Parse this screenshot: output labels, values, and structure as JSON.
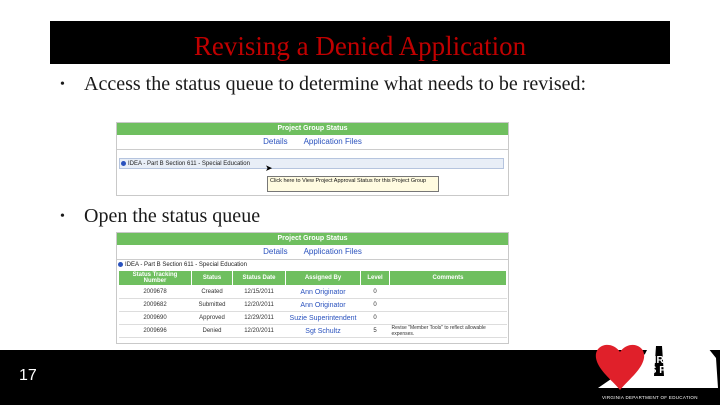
{
  "slide": {
    "title": "Revising a Denied Application",
    "bullets": [
      "Access the status queue to determine what needs to be revised:",
      "Open the status queue"
    ],
    "page_number": "17"
  },
  "screenshot1": {
    "header": "Project Group Status",
    "tabs": [
      "Details",
      "Application Files"
    ],
    "program_row": "IDEA - Part B Section 611 - Special Education",
    "tooltip": "Click here to View Project Approval Status for this Project Group"
  },
  "screenshot2": {
    "header": "Project Group Status",
    "tabs": [
      "Details",
      "Application Files"
    ],
    "program_row": "IDEA - Part B Section 611 - Special Education",
    "columns": [
      "Status Tracking Number",
      "Status",
      "Status Date",
      "Assigned By",
      "Level",
      "Comments"
    ],
    "rows": [
      {
        "number": "2009678",
        "status": "Created",
        "date": "12/15/2011",
        "assigned": "Ann Originator",
        "level": "0",
        "comments": ""
      },
      {
        "number": "2009682",
        "status": "Submitted",
        "date": "12/20/2011",
        "assigned": "Ann Originator",
        "level": "0",
        "comments": ""
      },
      {
        "number": "2009690",
        "status": "Approved",
        "date": "12/29/2011",
        "assigned": "Suzie Superintendent",
        "level": "0",
        "comments": ""
      },
      {
        "number": "2009696",
        "status": "Denied",
        "date": "12/20/2011",
        "assigned": "Sgt Schultz",
        "level": "5",
        "comments": "Revise \"Member Tools\" to reflect allowable expenses."
      }
    ]
  },
  "branding": {
    "logo_lines": [
      "VIRGINIA",
      "IS FOR",
      "LEARNERS"
    ],
    "logo_subtitle": "VIRGINIA DEPARTMENT OF EDUCATION",
    "colors": {
      "heart": "#e0202a",
      "title": "#c00000",
      "table_header": "#6fbf5f"
    }
  }
}
